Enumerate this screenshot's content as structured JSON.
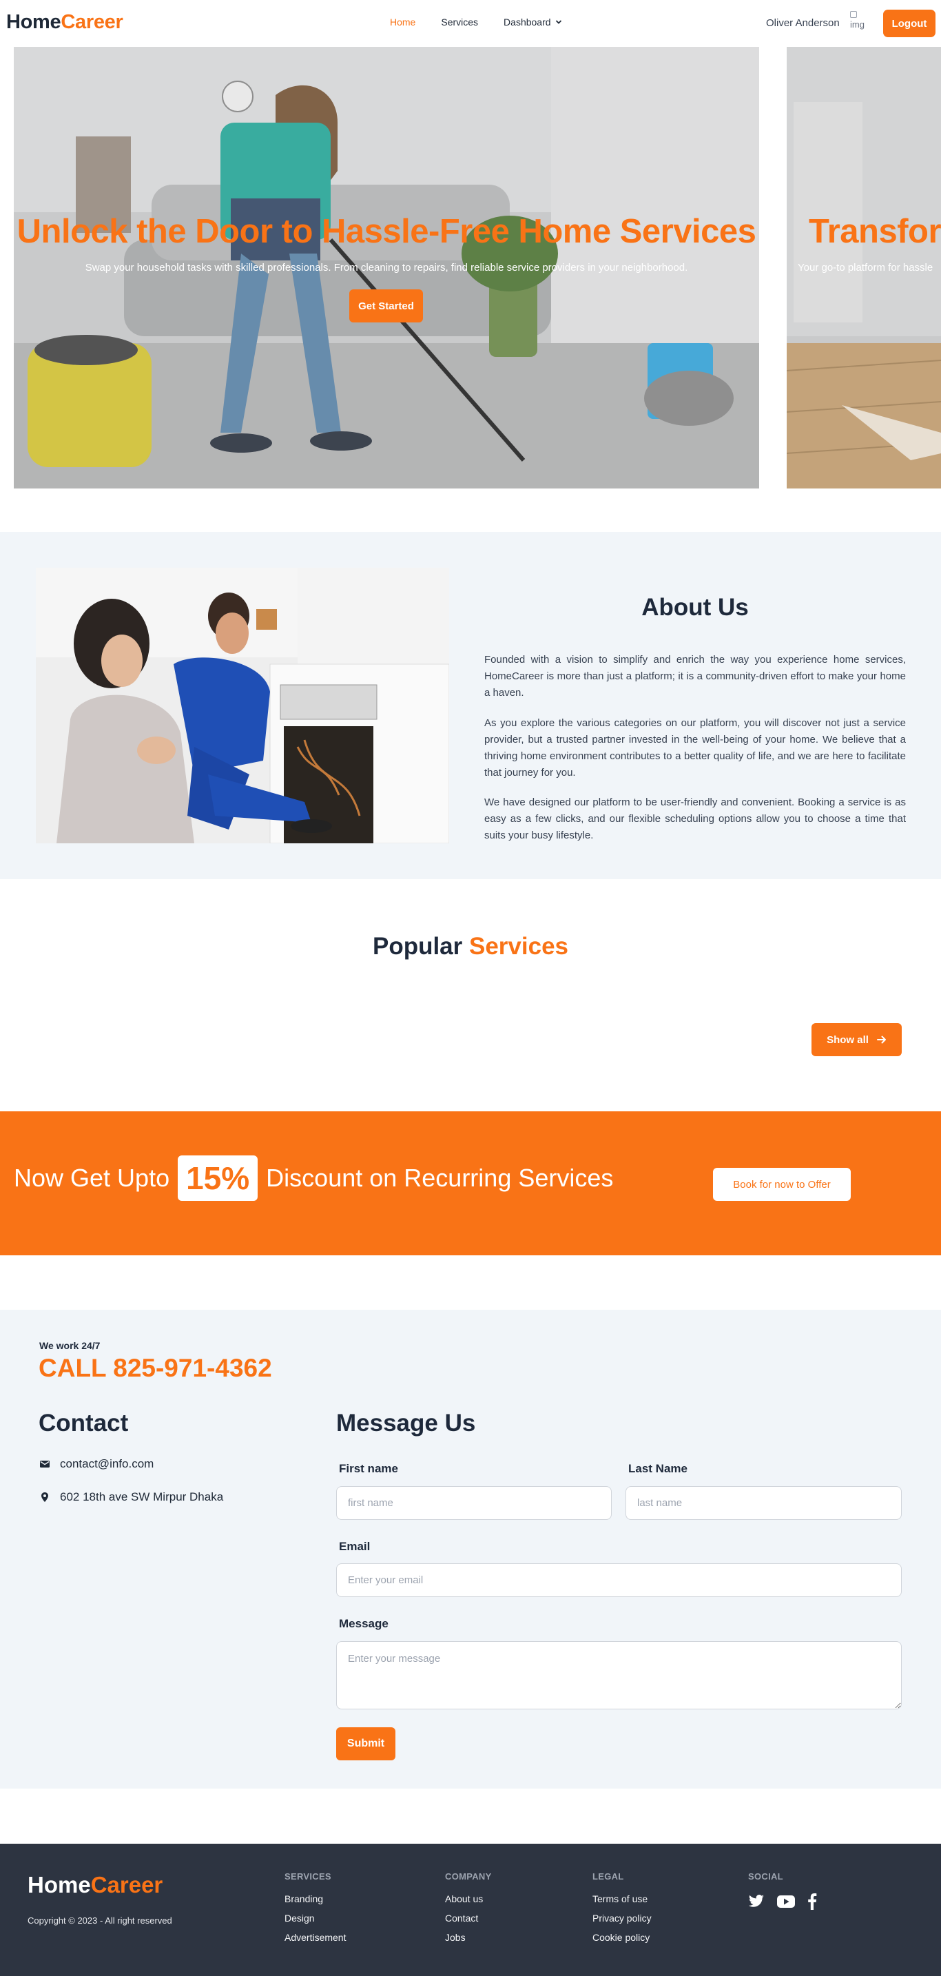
{
  "brand": {
    "name_part1": "Home",
    "name_part2": "Career",
    "accent": "#f97316"
  },
  "nav": {
    "home": "Home",
    "services": "Services",
    "dashboard": "Dashboard",
    "user_name": "Oliver Anderson",
    "avatar_alt": "img",
    "logout": "Logout"
  },
  "hero": {
    "slides": [
      {
        "title": "Unlock the Door to Hassle-Free Home Services",
        "subtitle": "Swap your household tasks with skilled professionals. From cleaning to repairs, find reliable service providers in your neighborhood.",
        "button": "Get Started"
      },
      {
        "title": "Transform",
        "subtitle": "Your go-to platform for hassle"
      }
    ]
  },
  "about": {
    "title": "About Us",
    "paragraphs": [
      "Founded with a vision to simplify and enrich the way you experience home services, HomeCareer is more than just a platform; it is a community-driven effort to make your home a haven.",
      "As you explore the various categories on our platform, you will discover not just a service provider, but a trusted partner invested in the well-being of your home. We believe that a thriving home environment contributes to a better quality of life, and we are here to facilitate that journey for you.",
      "We have designed our platform to be user-friendly and convenient. Booking a service is as easy as a few clicks, and our flexible scheduling options allow you to choose a time that suits your busy lifestyle."
    ]
  },
  "popular": {
    "title_part1": "Popular",
    "title_part2": "Services",
    "show_all": "Show all"
  },
  "discount": {
    "text_before": "Now Get Upto",
    "percent": "15%",
    "text_after": "Discount on Recurring Services",
    "button": "Book for now to Offer"
  },
  "contact": {
    "work_hours": "We work 24/7",
    "call": "CALL 825-971-4362",
    "heading": "Contact",
    "email": "contact@info.com",
    "address": "602 18th ave SW Mirpur Dhaka"
  },
  "message_form": {
    "heading": "Message Us",
    "first_name_label": "First name",
    "first_name_placeholder": "first name",
    "last_name_label": "Last Name",
    "last_name_placeholder": "last name",
    "email_label": "Email",
    "email_placeholder": "Enter your email",
    "message_label": "Message",
    "message_placeholder": "Enter your message",
    "submit": "Submit"
  },
  "footer": {
    "copyright": "Copyright © 2023 - All right reserved",
    "columns": [
      {
        "title": "SERVICES",
        "links": [
          "Branding",
          "Design",
          "Advertisement"
        ]
      },
      {
        "title": "COMPANY",
        "links": [
          "About us",
          "Contact",
          "Jobs"
        ]
      },
      {
        "title": "LEGAL",
        "links": [
          "Terms of use",
          "Privacy policy",
          "Cookie policy"
        ]
      },
      {
        "title": "SOCIAL",
        "icons": [
          "twitter-icon",
          "youtube-icon",
          "facebook-icon"
        ]
      }
    ]
  }
}
